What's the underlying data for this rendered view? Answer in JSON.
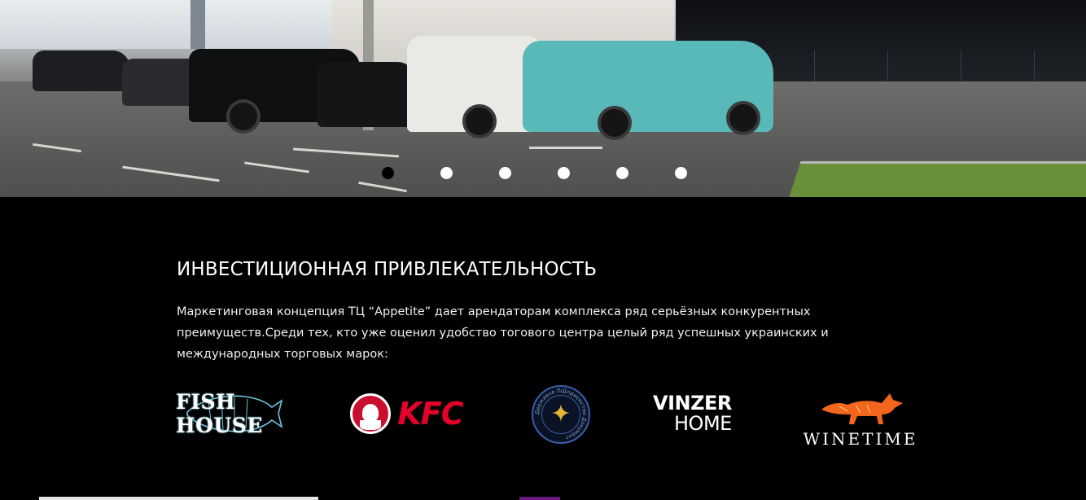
{
  "slider": {
    "dots": [
      {
        "active": true
      },
      {
        "active": false
      },
      {
        "active": false
      },
      {
        "active": false
      },
      {
        "active": false
      },
      {
        "active": false
      }
    ]
  },
  "section": {
    "title": "ИНВЕСТИЦИОННАЯ ПРИВЛЕКАТЕЛЬНОСТЬ",
    "description": "Маркетинговая концепция ТЦ “Appetite” дает арендаторам комплекса ряд серьёзных конкурентных преимуществ.Среди тех, кто уже оценил удобство тогового центра целый ряд успешных украинских и международных торговых марок:"
  },
  "brands": {
    "fish_house": "FISH HOUSE",
    "kfc": "KFC",
    "seal_outer_text": "Державне ПІДприємство Документ",
    "vinzer_line1": "VINZER",
    "vinzer_line2": "HOME",
    "winetime": "WINETIME"
  },
  "colors": {
    "background": "#000000",
    "kfc_red": "#e4002b",
    "fox_orange": "#f2661c",
    "seal_blue": "#3b5ea8"
  }
}
